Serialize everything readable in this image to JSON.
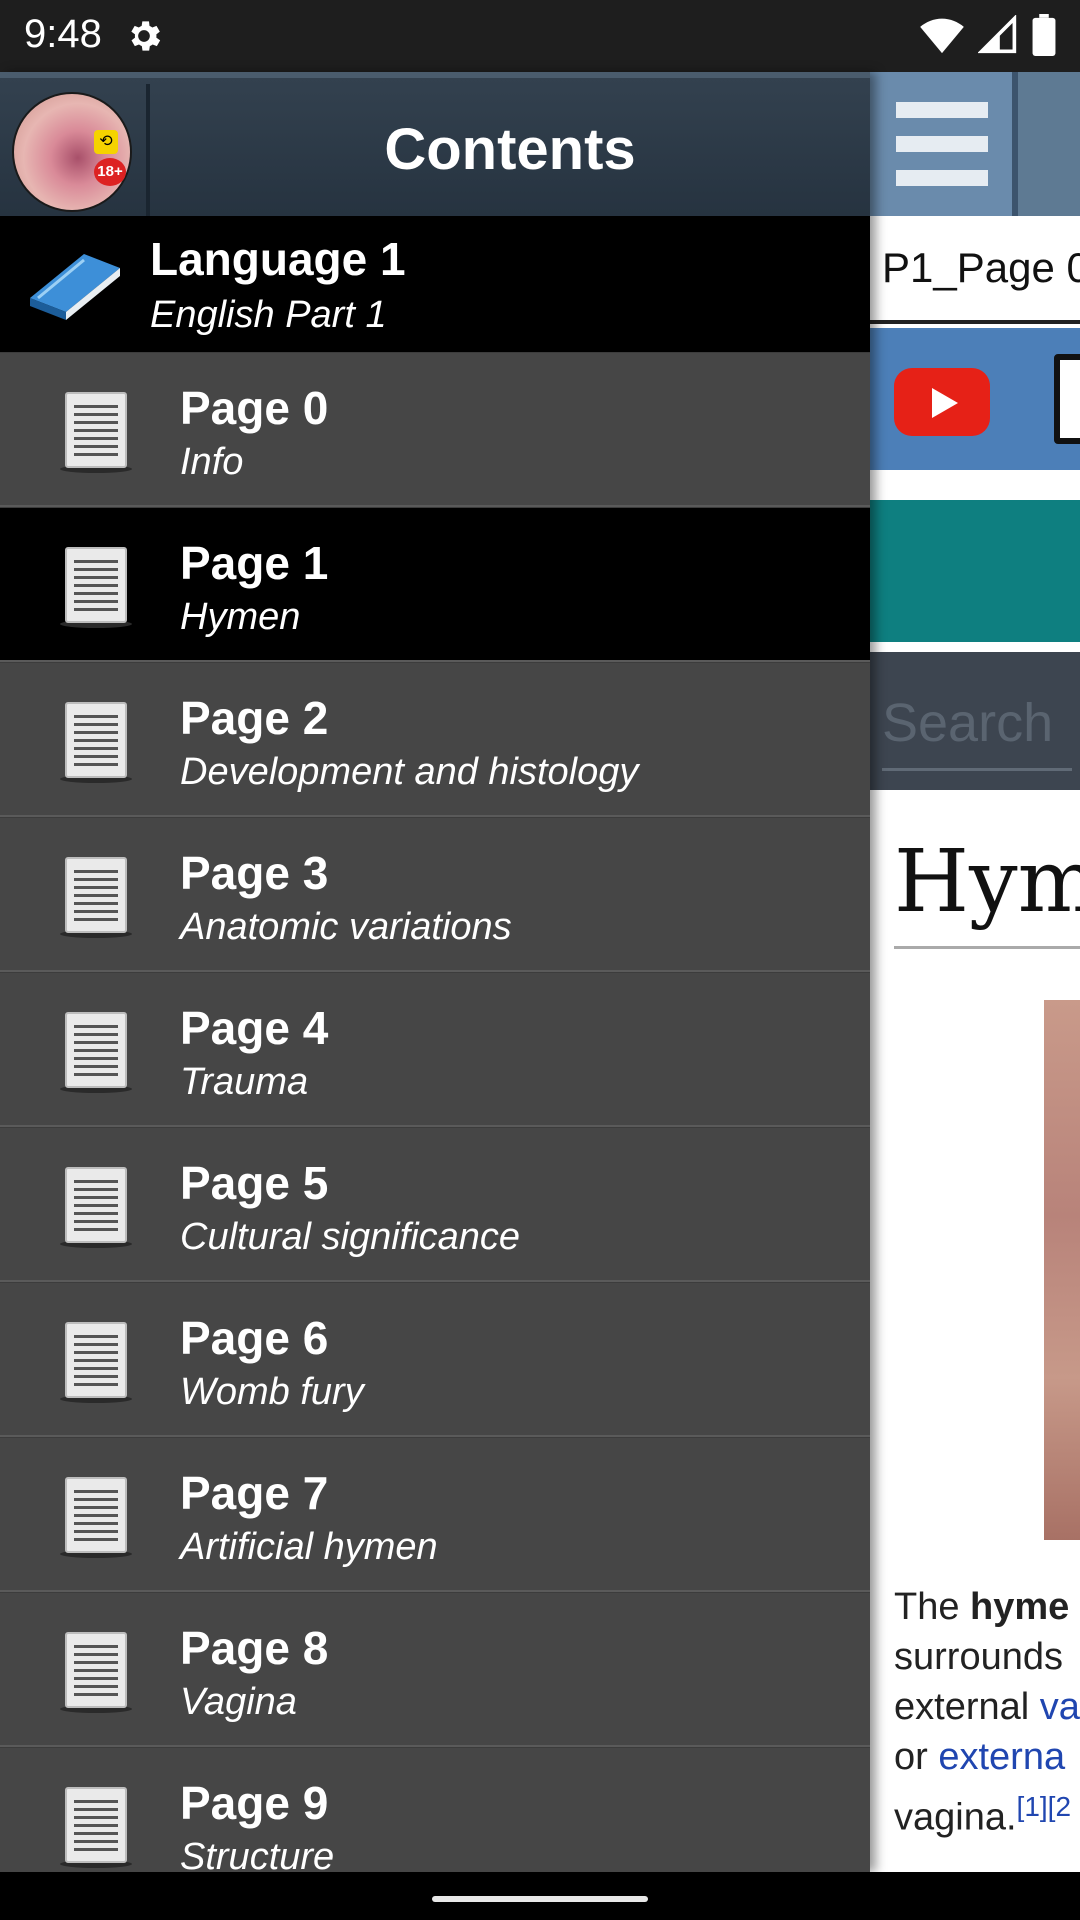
{
  "status_bar": {
    "time": "9:48",
    "icons": [
      "gear-icon",
      "wifi-icon",
      "signal-icon",
      "battery-icon"
    ]
  },
  "drawer": {
    "title": "Contents",
    "language": {
      "title": "Language 1",
      "subtitle": "English Part 1",
      "icon": "book-icon"
    },
    "items": [
      {
        "title": "Page 0",
        "subtitle": "Info",
        "selected": false
      },
      {
        "title": "Page 1",
        "subtitle": "Hymen",
        "selected": true
      },
      {
        "title": "Page 2",
        "subtitle": "Development and histology",
        "selected": false
      },
      {
        "title": "Page 3",
        "subtitle": "Anatomic variations",
        "selected": false
      },
      {
        "title": "Page 4",
        "subtitle": "Trauma",
        "selected": false
      },
      {
        "title": "Page 5",
        "subtitle": "Cultural significance",
        "selected": false
      },
      {
        "title": "Page 6",
        "subtitle": "Womb fury",
        "selected": false
      },
      {
        "title": "Page 7",
        "subtitle": "Artificial hymen",
        "selected": false
      },
      {
        "title": "Page 8",
        "subtitle": "Vagina",
        "selected": false
      },
      {
        "title": "Page 9",
        "subtitle": "Structure",
        "selected": false
      }
    ]
  },
  "background_page": {
    "page_label": "P1_Page 0",
    "search_placeholder": "Search",
    "heading": "Hym",
    "text_lines": [
      {
        "parts": [
          [
            "The ",
            "plain"
          ],
          [
            "hyme",
            "bold"
          ]
        ]
      },
      {
        "parts": [
          [
            "surrounds",
            "plain"
          ]
        ]
      },
      {
        "parts": [
          [
            "external ",
            "plain"
          ],
          [
            "va",
            "link"
          ]
        ]
      },
      {
        "parts": [
          [
            "or ",
            "plain"
          ],
          [
            "externa",
            "link"
          ]
        ]
      },
      {
        "parts": [
          [
            "vagina.",
            "plain"
          ],
          [
            "[1][2",
            "sup"
          ]
        ]
      }
    ]
  },
  "colors": {
    "drawer_bg": "#464646",
    "selected_bg": "#000000",
    "header_bg": "#2b3845",
    "teal": "#0e7f80",
    "link": "#2046b0"
  }
}
